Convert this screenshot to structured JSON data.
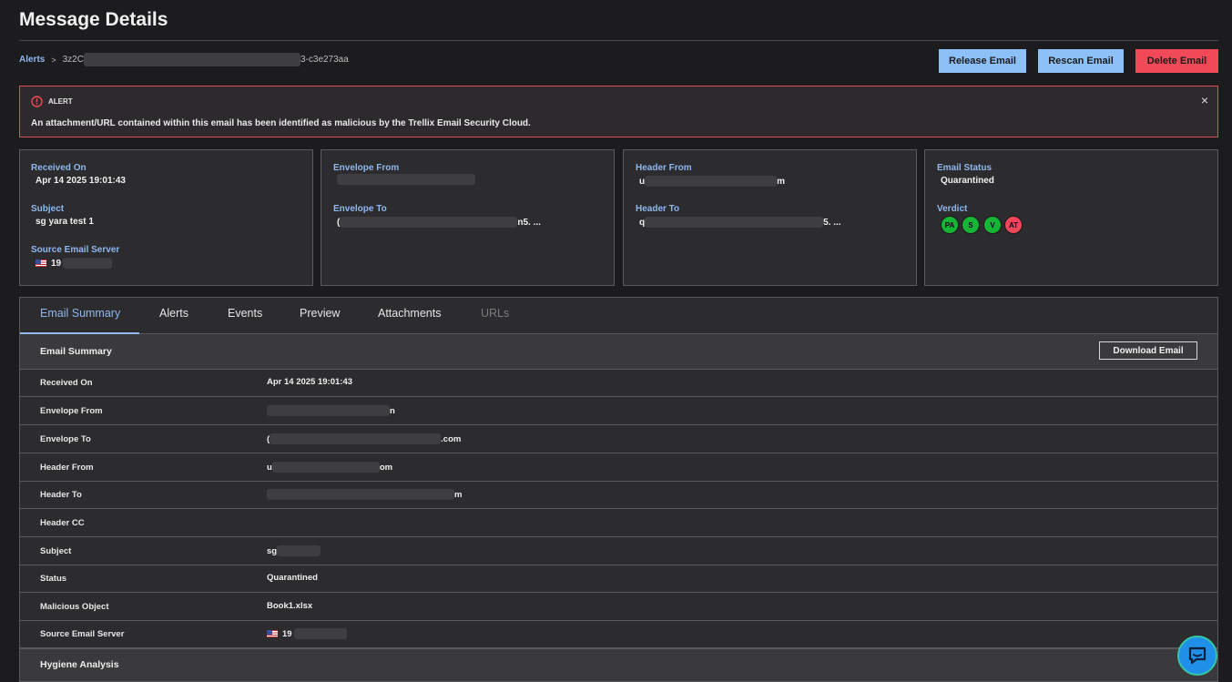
{
  "page": {
    "title": "Message Details"
  },
  "breadcrumb": {
    "parent": "Alerts",
    "separator": ">",
    "id_prefix": "3z2C",
    "id_suffix": "3-c3e273aa"
  },
  "actions": {
    "release": "Release Email",
    "rescan": "Rescan Email",
    "delete": "Delete Email"
  },
  "alert": {
    "heading": "ALERT",
    "message": "An attachment/URL contained within this email has been identified as malicious by the Trellix Email Security Cloud.",
    "close": "×"
  },
  "cards": {
    "received_label": "Received On",
    "received_value": "Apr 14 2025 19:01:43",
    "subject_label": "Subject",
    "subject_value": "sg yara test 1",
    "source_label": "Source Email Server",
    "source_value": "19",
    "env_from_label": "Envelope From",
    "env_to_label": "Envelope To",
    "env_to_value_prefix": "(",
    "env_to_value_suffix": "n5. ...",
    "hdr_from_label": "Header From",
    "hdr_from_value_prefix": "u",
    "hdr_from_value_suffix": "m",
    "hdr_to_label": "Header To",
    "hdr_to_value_prefix": "q",
    "hdr_to_value_suffix": "5. ...",
    "status_label": "Email Status",
    "status_value": "Quarantined",
    "verdict_label": "Verdict",
    "verdicts": [
      {
        "code": "PA",
        "color": "#16b535"
      },
      {
        "code": "S",
        "color": "#16b535"
      },
      {
        "code": "V",
        "color": "#16b535"
      },
      {
        "code": "AT",
        "color": "#f0475a"
      }
    ]
  },
  "tabs": [
    "Email Summary",
    "Alerts",
    "Events",
    "Preview",
    "Attachments",
    "URLs"
  ],
  "summary": {
    "title": "Email Summary",
    "download": "Download Email",
    "rows": [
      {
        "key": "Received On",
        "prefix": "Apr 14 2025 19:01:43",
        "suffix": ""
      },
      {
        "key": "Envelope From",
        "prefix": "",
        "suffix": "n"
      },
      {
        "key": "Envelope To",
        "prefix": "(",
        "suffix": ".com"
      },
      {
        "key": "Header From",
        "prefix": "u",
        "suffix": "om"
      },
      {
        "key": "Header To",
        "prefix": "",
        "suffix": "m"
      },
      {
        "key": "Header CC",
        "prefix": "",
        "suffix": ""
      },
      {
        "key": "Subject",
        "prefix": "sg",
        "suffix": ""
      },
      {
        "key": "Status",
        "prefix": "Quarantined",
        "suffix": ""
      },
      {
        "key": "Malicious Object",
        "prefix": "Book1.xlsx",
        "suffix": ""
      },
      {
        "key": "Source Email Server",
        "prefix": "19",
        "suffix": ""
      }
    ],
    "hygiene_title": "Hygiene Analysis"
  },
  "colors": {
    "accent": "#8fb8ee",
    "danger": "#f04a59",
    "button_blue": "#8ec0f8",
    "background": "#1c1b1d"
  }
}
